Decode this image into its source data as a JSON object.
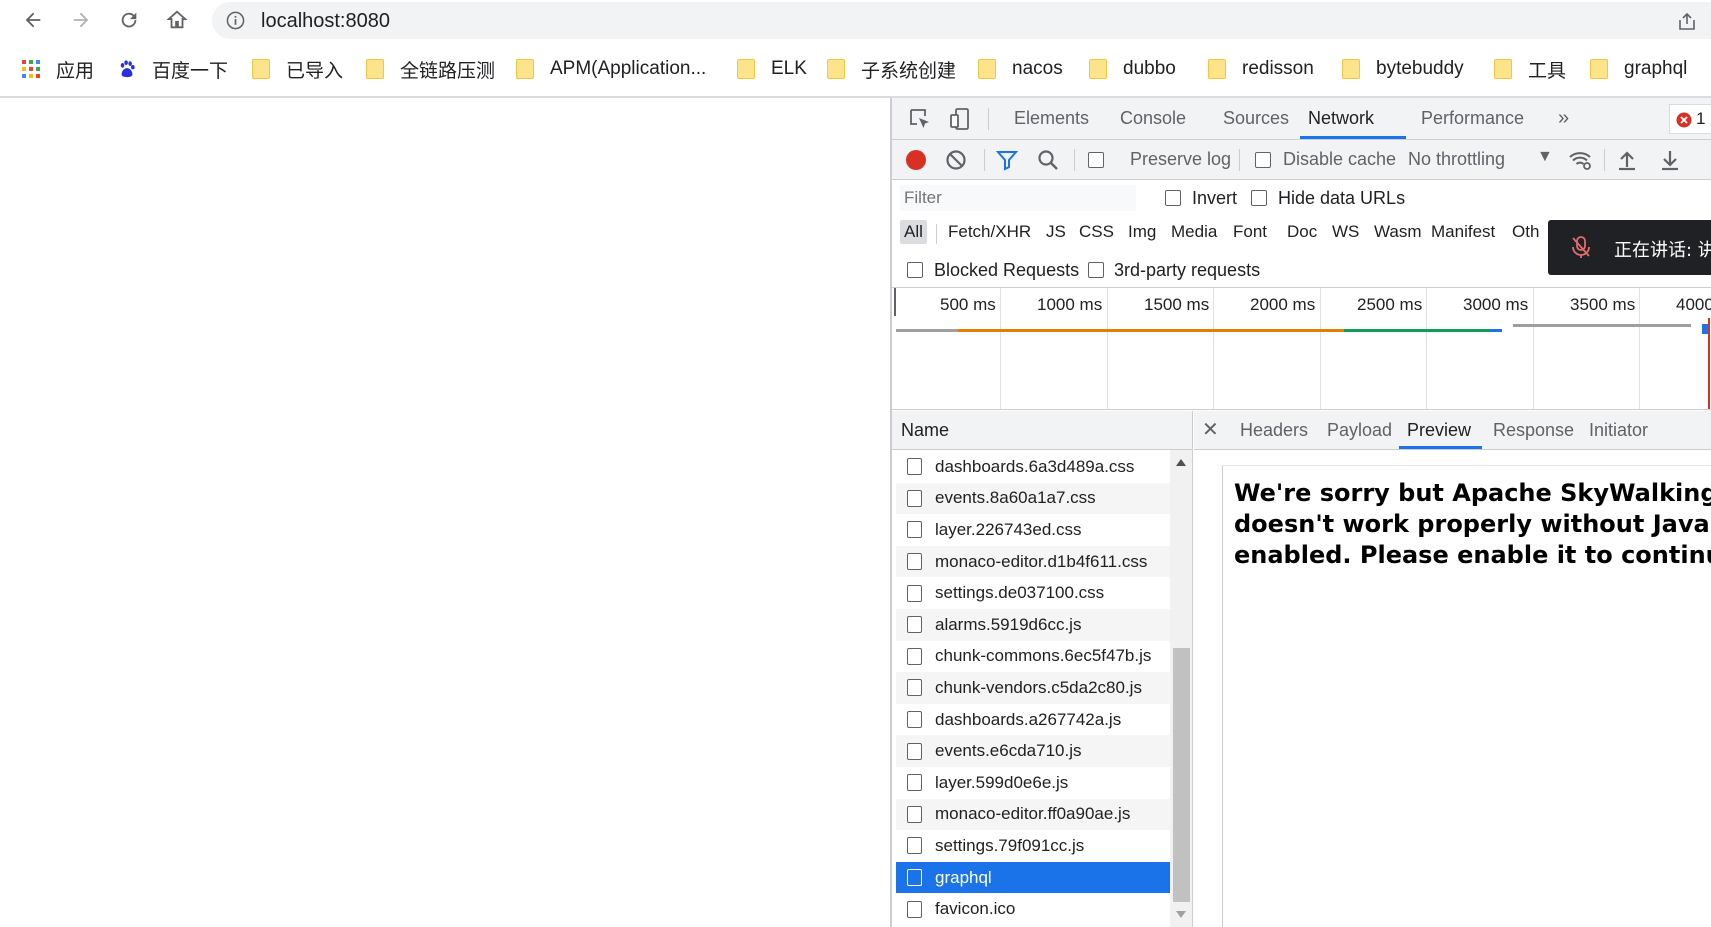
{
  "browser": {
    "url": "localhost:8080",
    "bookmarks": [
      {
        "label": "应用",
        "icon": "apps-grid-icon"
      },
      {
        "label": "百度一下",
        "icon": "baidu-paw-icon"
      },
      {
        "label": "已导入",
        "icon": "folder-icon"
      },
      {
        "label": "全链路压测",
        "icon": "folder-icon"
      },
      {
        "label": "APM(Application...",
        "icon": "folder-icon"
      },
      {
        "label": "ELK",
        "icon": "folder-icon"
      },
      {
        "label": "子系统创建",
        "icon": "folder-icon"
      },
      {
        "label": "nacos",
        "icon": "folder-icon"
      },
      {
        "label": "dubbo",
        "icon": "folder-icon"
      },
      {
        "label": "redisson",
        "icon": "folder-icon"
      },
      {
        "label": "bytebuddy",
        "icon": "folder-icon"
      },
      {
        "label": "工具",
        "icon": "folder-icon"
      },
      {
        "label": "graphql",
        "icon": "folder-icon"
      }
    ]
  },
  "devtools": {
    "tabs": [
      "Elements",
      "Console",
      "Sources",
      "Network",
      "Performance"
    ],
    "active_tab": "Network",
    "error_count": "1",
    "network_toolbar": {
      "preserve_log": "Preserve log",
      "disable_cache": "Disable cache",
      "throttling": "No throttling"
    },
    "filter": {
      "placeholder": "Filter",
      "invert": "Invert",
      "hide_data_urls": "Hide data URLs"
    },
    "types": [
      "All",
      "Fetch/XHR",
      "JS",
      "CSS",
      "Img",
      "Media",
      "Font",
      "Doc",
      "WS",
      "Wasm",
      "Manifest",
      "Oth"
    ],
    "active_type": "All",
    "blocked_requests": "Blocked Requests",
    "third_party": "3rd-party requests",
    "timeline_ticks": [
      "500 ms",
      "1000 ms",
      "1500 ms",
      "2000 ms",
      "2500 ms",
      "3000 ms",
      "3500 ms",
      "4000"
    ],
    "notification": "正在讲话: 讲",
    "request_list": {
      "header": "Name",
      "rows": [
        "dashboards.6a3d489a.css",
        "events.8a60a1a7.css",
        "layer.226743ed.css",
        "monaco-editor.d1b4f611.css",
        "settings.de037100.css",
        "alarms.5919d6cc.js",
        "chunk-commons.6ec5f47b.js",
        "chunk-vendors.c5da2c80.js",
        "dashboards.a267742a.js",
        "events.e6cda710.js",
        "layer.599d0e6e.js",
        "monaco-editor.ff0a90ae.js",
        "settings.79f091cc.js",
        "graphql",
        "favicon.ico"
      ],
      "selected": "graphql"
    },
    "detail_tabs": [
      "Headers",
      "Payload",
      "Preview",
      "Response",
      "Initiator"
    ],
    "active_detail_tab": "Preview",
    "preview_text": "We're sorry but Apache SkyWalking doesn't work properly without JavaScript enabled. Please enable it to continue."
  },
  "colors": {
    "accent": "#1a73e8",
    "record": "#d93025",
    "error": "#d93025"
  }
}
